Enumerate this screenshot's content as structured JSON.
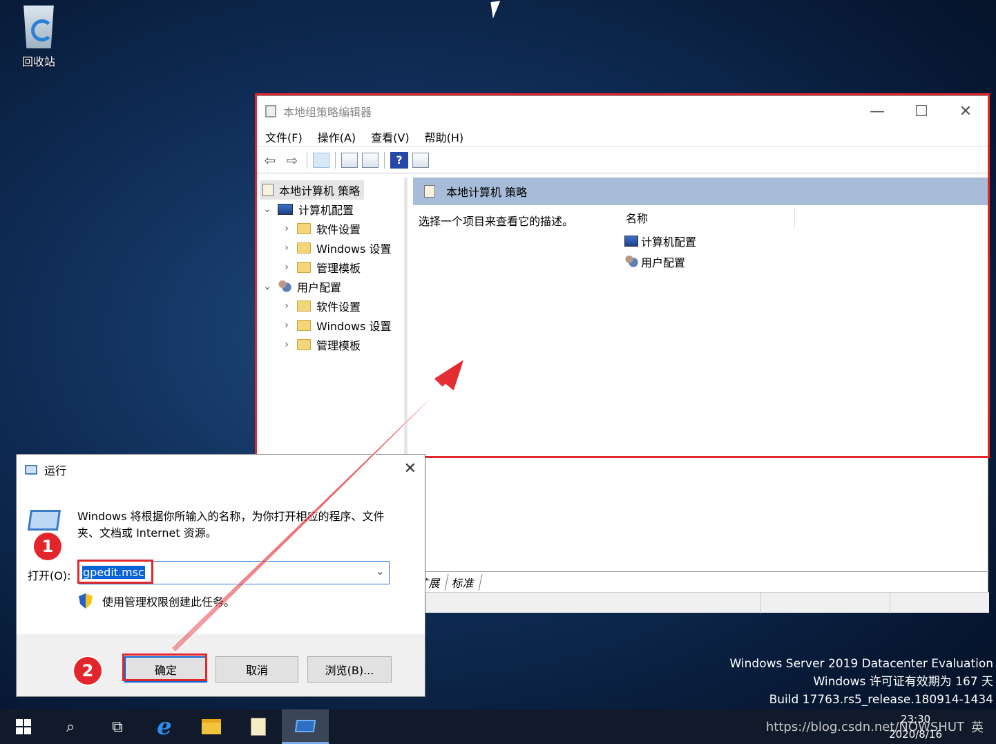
{
  "desktop": {
    "recycle_bin_label": "回收站",
    "watermark_lines": [
      "Windows Server 2019 Datacenter Evaluation",
      "Windows 许可证有效期为 167 天",
      "Build 17763.rs5_release.180914-1434"
    ]
  },
  "gpedit": {
    "title": "本地组策略编辑器",
    "menu": [
      "文件(F)",
      "操作(A)",
      "查看(V)",
      "帮助(H)"
    ],
    "tree": {
      "root": "本地计算机 策略",
      "computer_config": "计算机配置",
      "computer_children": [
        "软件设置",
        "Windows 设置",
        "管理模板"
      ],
      "user_config": "用户配置",
      "user_children": [
        "软件设置",
        "Windows 设置",
        "管理模板"
      ]
    },
    "right": {
      "header": "本地计算机 策略",
      "description": "选择一个项目来查看它的描述。",
      "column_name": "名称",
      "items": [
        "计算机配置",
        "用户配置"
      ],
      "tabs": [
        "扩展",
        "标准"
      ]
    }
  },
  "run_dialog": {
    "title": "运行",
    "description": "Windows 将根据你所输入的名称，为你打开相应的程序、文件夹、文档或 Internet 资源。",
    "open_label": "打开(O):",
    "input_value": "gpedit.msc",
    "admin_text": "使用管理权限创建此任务。",
    "buttons": {
      "ok": "确定",
      "cancel": "取消",
      "browse": "浏览(B)..."
    }
  },
  "annotations": {
    "step1": "1",
    "step2": "2"
  },
  "taskbar": {
    "time": "23:30",
    "date": "2020/8/16",
    "tray_text": "https://blog.csdn.net/NOWSHUT",
    "ime": "英"
  },
  "colors": {
    "highlight_red": "#e3262b",
    "selection_blue": "#0a64d8",
    "pane_header": "#a6bcd8"
  }
}
